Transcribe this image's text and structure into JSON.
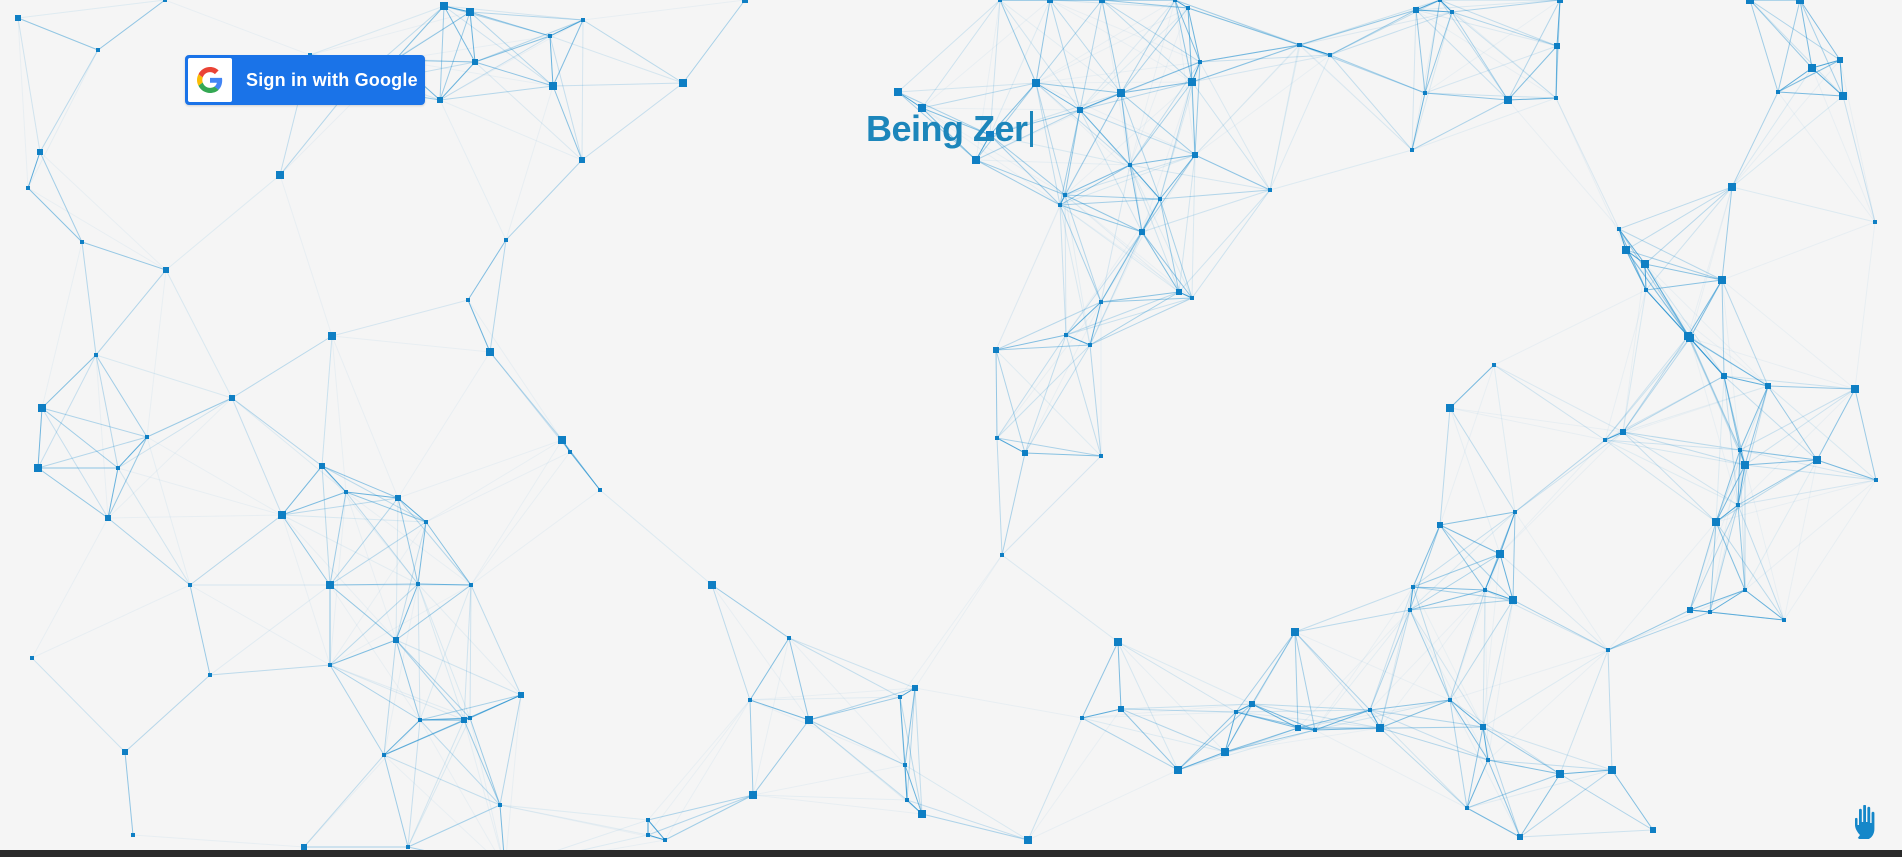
{
  "page": {
    "title_text": "Being Zer"
  },
  "auth": {
    "google_button_label": "Sign in with Google"
  },
  "colors": {
    "background": "#f5f5f5",
    "network": "#1f8fd0",
    "node": "#0f7fc4",
    "title": "#1c86bb",
    "google_button": "#1a73e8"
  },
  "icons": {
    "google": "google-g-logo",
    "hand": "raised-hand"
  }
}
